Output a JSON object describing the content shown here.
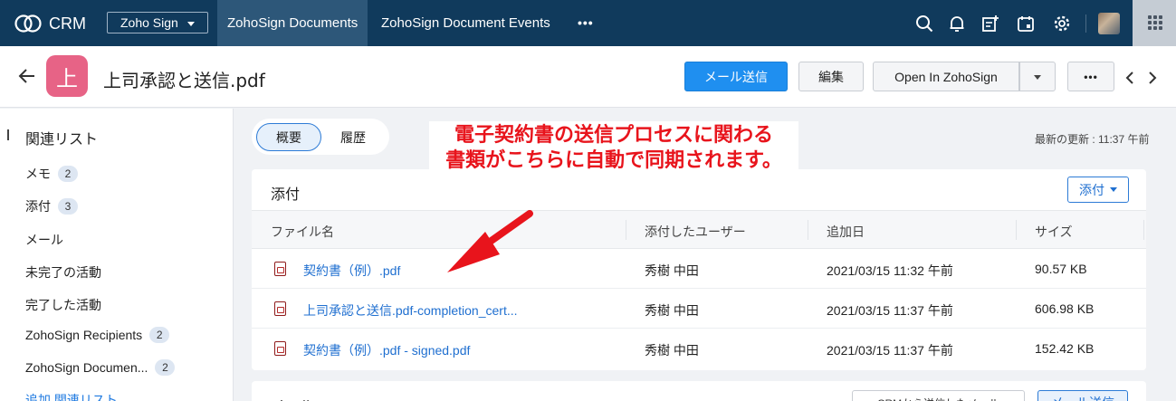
{
  "topbar": {
    "logo_text": "CRM",
    "module_select": "Zoho Sign",
    "tabs": [
      {
        "label": "ZohoSign Documents",
        "active": true
      },
      {
        "label": "ZohoSign Document Events",
        "active": false
      }
    ],
    "more_label": "•••",
    "icons": [
      "search-icon",
      "bell-icon",
      "add-note-icon",
      "calendar-icon",
      "gear-icon",
      "avatar",
      "apps-grid-icon"
    ],
    "colors": {
      "bar": "#103a5c",
      "active_tab": "#2d5779"
    }
  },
  "record": {
    "icon_letter": "上",
    "title": "上司承認と送信.pdf",
    "buttons": {
      "send_mail": "メール送信",
      "edit": "編集",
      "open_in": "Open In ZohoSign",
      "more": "•••"
    }
  },
  "sidebar": {
    "title": "関連リスト",
    "items": [
      {
        "label": "メモ",
        "count": "2"
      },
      {
        "label": "添付",
        "count": "3"
      },
      {
        "label": "メール",
        "count": ""
      },
      {
        "label": "未完了の活動",
        "count": ""
      },
      {
        "label": "完了した活動",
        "count": ""
      },
      {
        "label": "ZohoSign Recipients",
        "count": "2"
      },
      {
        "label": "ZohoSign Documen...",
        "count": "2"
      }
    ],
    "add_link": "追加 関連リスト"
  },
  "view_toggle": {
    "overview": "概要",
    "history": "履歴"
  },
  "annotation": {
    "line1": "電子契約書の送信プロセスに関わる",
    "line2": "書類がこちらに自動で同期されます。",
    "color": "#e8141c"
  },
  "last_updated": "最新の更新 : 11:37 午前",
  "attachments": {
    "title": "添付",
    "attach_button": "添付",
    "columns": [
      "ファイル名",
      "添付したユーザー",
      "追加日",
      "サイズ"
    ],
    "rows": [
      {
        "file": "契約書（例）.pdf",
        "user": "秀樹 中田",
        "date": "2021/03/15 11:32 午前",
        "size": "90.57 KB"
      },
      {
        "file": "上司承認と送信.pdf-completion_cert...",
        "user": "秀樹 中田",
        "date": "2021/03/15 11:37 午前",
        "size": "606.98 KB"
      },
      {
        "file": "契約書（例）.pdf - signed.pdf",
        "user": "秀樹 中田",
        "date": "2021/03/15 11:37 午前",
        "size": "152.42 KB"
      }
    ]
  },
  "mail_section": {
    "title": "メール",
    "button_secondary": "CRMから送信したメール",
    "button_primary": "メール送信"
  }
}
